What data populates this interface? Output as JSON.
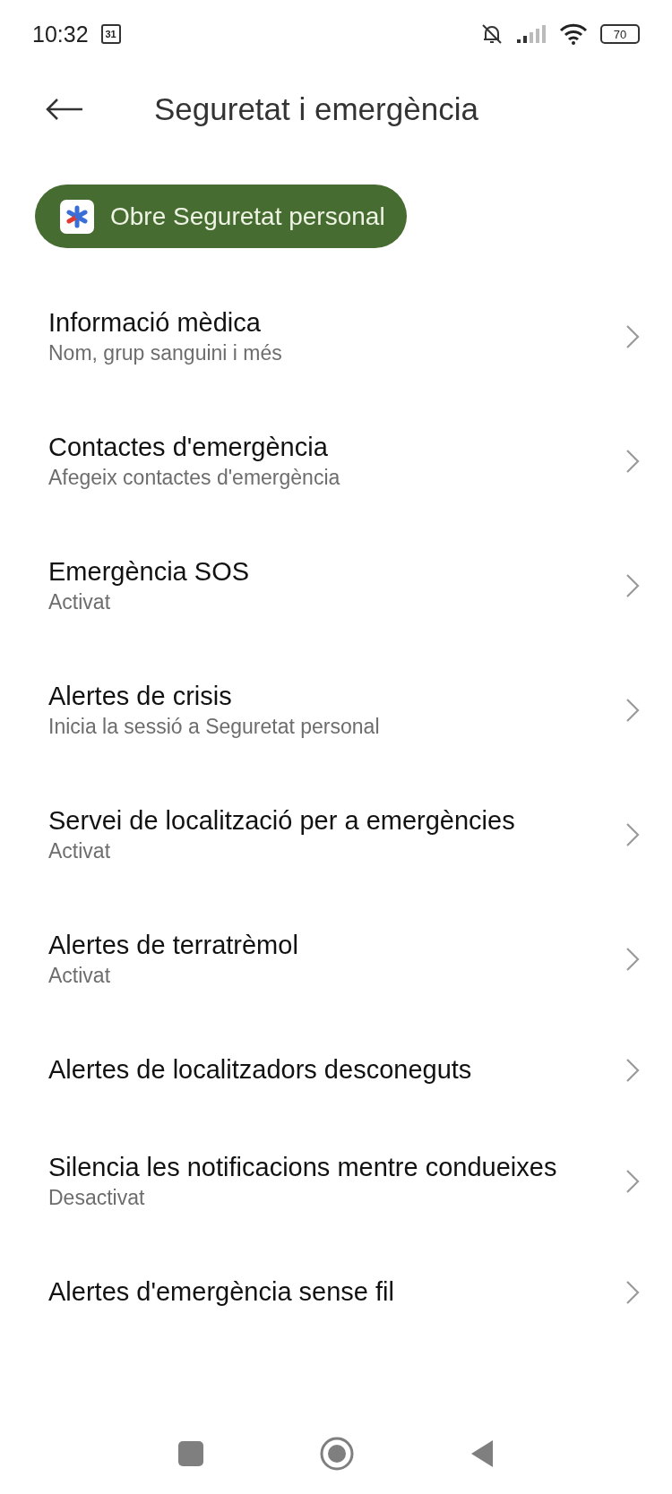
{
  "status_bar": {
    "time": "10:32",
    "calendar_day": "31",
    "battery": "70"
  },
  "header": {
    "title": "Seguretat i emergència"
  },
  "primary_button": {
    "label": "Obre Seguretat personal"
  },
  "items": [
    {
      "title": "Informació mèdica",
      "subtitle": "Nom, grup sanguini i més"
    },
    {
      "title": "Contactes d'emergència",
      "subtitle": "Afegeix contactes d'emergència"
    },
    {
      "title": "Emergència SOS",
      "subtitle": "Activat"
    },
    {
      "title": "Alertes de crisis",
      "subtitle": "Inicia la sessió a Seguretat personal"
    },
    {
      "title": "Servei de localització per a emergències",
      "subtitle": "Activat"
    },
    {
      "title": "Alertes de terratrèmol",
      "subtitle": "Activat"
    },
    {
      "title": "Alertes de localitzadors desconeguts"
    },
    {
      "title": "Silencia les notificacions mentre condueixes",
      "subtitle": "Desactivat"
    },
    {
      "title": "Alertes d'emergència sense fil"
    }
  ]
}
